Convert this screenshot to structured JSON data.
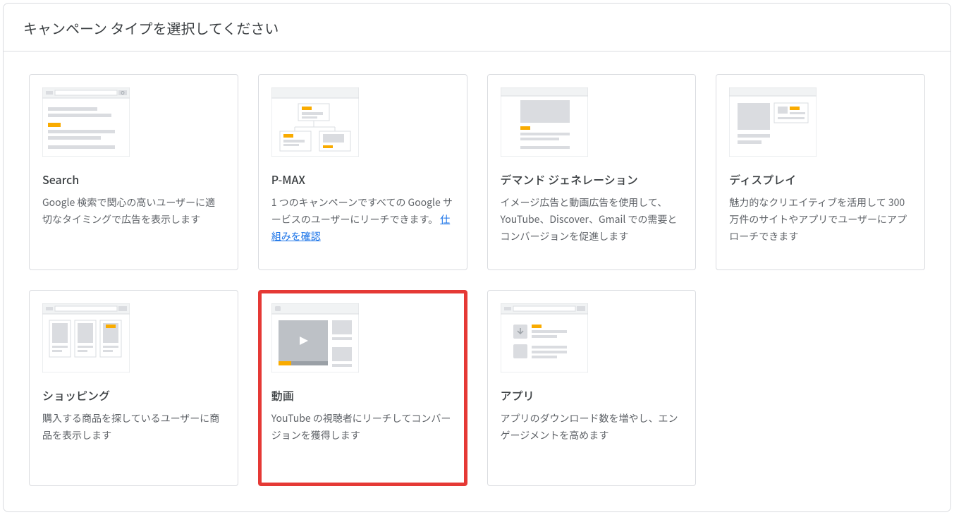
{
  "header": {
    "title": "キャンペーン タイプを選択してください"
  },
  "cards": [
    {
      "id": "search",
      "title": "Search",
      "desc": "Google 検索で関心の高いユーザーに適切なタイミングで広告を表示します",
      "link": null,
      "highlighted": false
    },
    {
      "id": "pmax",
      "title": "P-MAX",
      "desc": "1 つのキャンペーンですべての Google サービスのユーザーにリーチできます。 ",
      "link": "仕組みを確認",
      "highlighted": false
    },
    {
      "id": "demand-gen",
      "title": "デマンド ジェネレーション",
      "desc": "イメージ広告と動画広告を使用して、YouTube、Discover、Gmail での需要とコンバージョンを促進します",
      "link": null,
      "highlighted": false
    },
    {
      "id": "display",
      "title": "ディスプレイ",
      "desc": "魅力的なクリエイティブを活用して 300 万件のサイトやアプリでユーザーにアプローチできます",
      "link": null,
      "highlighted": false
    },
    {
      "id": "shopping",
      "title": "ショッピング",
      "desc": "購入する商品を探しているユーザーに商品を表示します",
      "link": null,
      "highlighted": false
    },
    {
      "id": "video",
      "title": "動画",
      "desc": "YouTube の視聴者にリーチしてコンバージョンを獲得します",
      "link": null,
      "highlighted": true
    },
    {
      "id": "app",
      "title": "アプリ",
      "desc": "アプリのダウンロード数を増やし、エンゲージメントを高めます",
      "link": null,
      "highlighted": false
    }
  ]
}
